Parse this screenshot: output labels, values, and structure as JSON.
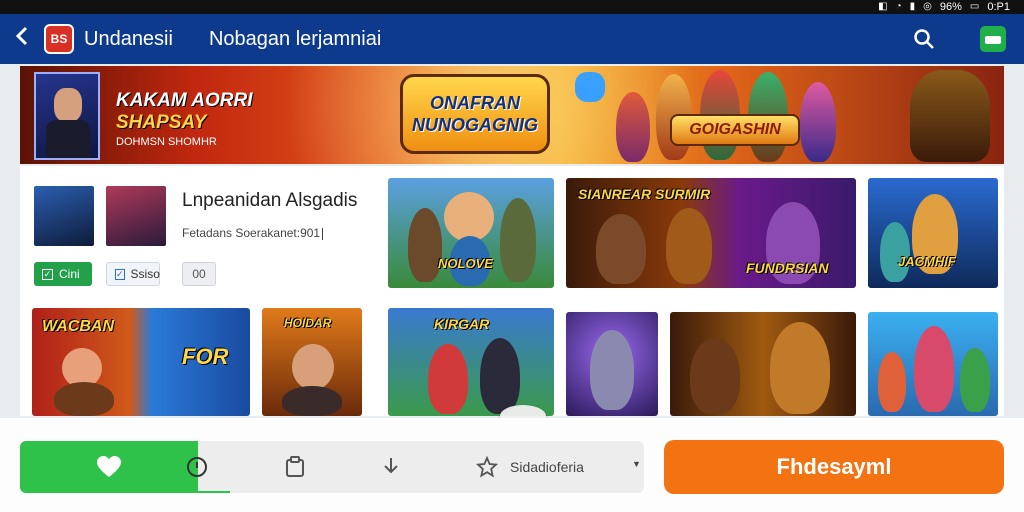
{
  "status_bar": {
    "battery": "96%",
    "time": "0:P1"
  },
  "top_bar": {
    "app_logo": "BS",
    "app_title": "Undanesii",
    "section_title": "Nobagan lerjamniai",
    "search_icon": "search-icon",
    "action_icon": "chat-icon"
  },
  "banner": {
    "line1": "KAKAM AORRI",
    "line2": "SHAPSAY",
    "line3": "DOHMSN SHOMHR",
    "logo_line1": "ONAFRAN",
    "logo_line2": "NUNOGAGNIG",
    "logo2": "GOIGASHIN"
  },
  "featured": {
    "title": "Lnpeanidan Alsgadis",
    "meta": "Fetadans Soerakanet:901",
    "pill_green": "Cini",
    "pill_blue": "Ssiso",
    "pill_gray": "00"
  },
  "tiles": {
    "t1": "NOLOVE",
    "t2": "SIANREAR SURMIR",
    "t3": "FUNDRSIAN",
    "t4": "JACMHIF",
    "t5": "WACBAN",
    "t6": "FOR",
    "t7": "HOIDAR",
    "t8": "KIRGAR"
  },
  "bottom_bar": {
    "dropdown_label": "Sidadioferia",
    "cta_label": "Fhdesayml"
  },
  "colors": {
    "topbar": "#0d3a8c",
    "green": "#2fc24a",
    "cta": "#f37212"
  }
}
